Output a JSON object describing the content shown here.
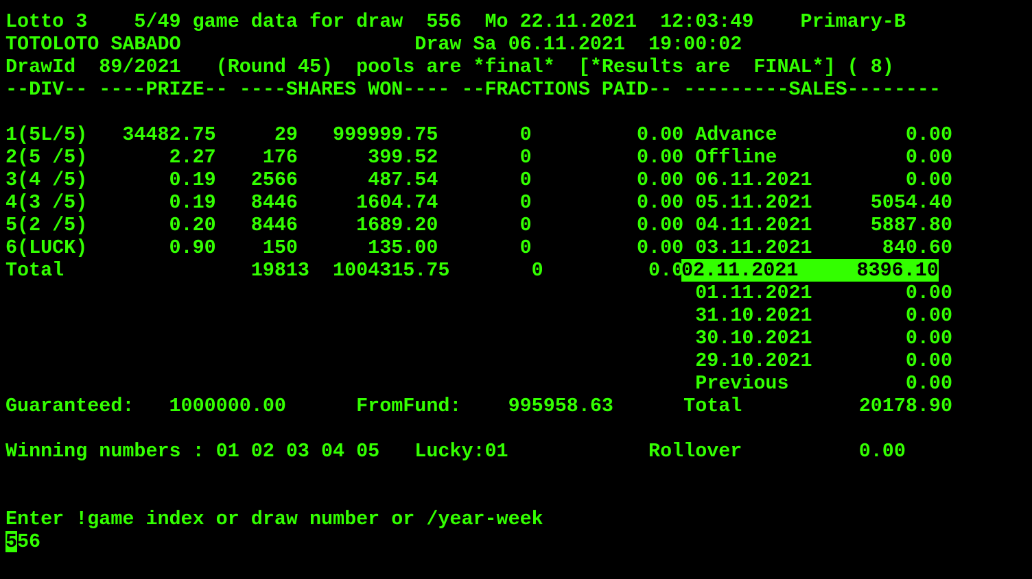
{
  "colors": {
    "background": "#000000",
    "foreground": "#33ff00",
    "selection_background": "#33ff00",
    "selection_text": "#000000"
  },
  "screen": {
    "lines": [
      "Lotto 3    5/49 game data for draw  556  Mo 22.11.2021  12:03:49    Primary-B",
      "TOTOLOTO SABADO                    Draw Sa 06.11.2021  19:00:02",
      "DrawId  89/2021   (Round 45)  pools are *final*  [*Results are  FINAL*] ( 8)",
      "--DIV-- ----PRIZE-- ----SHARES WON---- --FRACTIONS PAID-- ---------SALES--------",
      "",
      "1(5L/5)   34482.75     29   999999.75       0         0.00 Advance           0.00",
      "2(5 /5)       2.27    176      399.52       0         0.00 Offline           0.00",
      "3(4 /5)       0.19   2566      487.54       0         0.00 06.11.2021        0.00",
      "4(3 /5)       0.19   8446     1604.74       0         0.00 05.11.2021     5054.40",
      "5(2 /5)       0.20   8446     1689.20       0         0.00 04.11.2021     5887.80",
      "6(LUCK)       0.90    150      135.00       0         0.00 03.11.2021      840.60",
      "Total                19813  1004315.75       0         0.00 ",
      "                                                           01.11.2021        0.00",
      "                                                           31.10.2021        0.00",
      "                                                           30.10.2021        0.00",
      "                                                           29.10.2021        0.00",
      "                                                           Previous          0.00",
      "Guaranteed:   1000000.00      FromFund:    995958.63      Total          20178.90",
      "",
      "Winning numbers : 01 02 03 04 05   Lucky:01            Rollover          0.00",
      "",
      "",
      "Enter !game index or draw number or /year-week"
    ],
    "selected_sales_row": "02.11.2021     8396.10",
    "input": {
      "cursor_char": "5",
      "rest": "56"
    }
  }
}
